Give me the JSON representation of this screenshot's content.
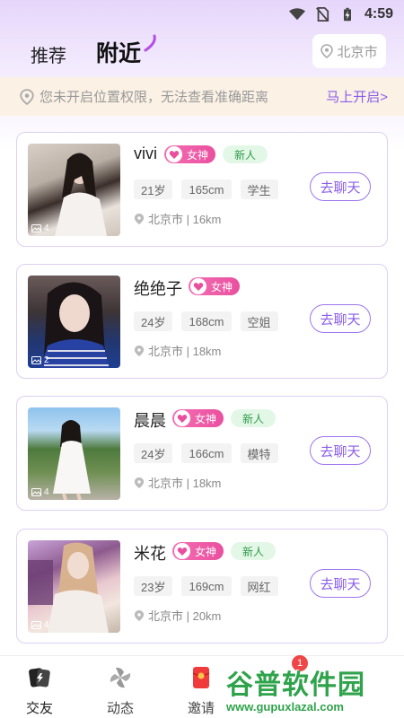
{
  "status_bar": {
    "time": "4:59"
  },
  "header": {
    "tabs": [
      {
        "label": "推荐",
        "active": false
      },
      {
        "label": "附近",
        "active": true
      }
    ],
    "city": "北京市"
  },
  "location_banner": {
    "message": "您未开启位置权限，无法查看准确距离",
    "action": "马上开启>"
  },
  "users": [
    {
      "name": "vivi",
      "badges": [
        "女神",
        "新人"
      ],
      "tags": [
        "21岁",
        "165cm",
        "学生"
      ],
      "location": "北京市 | 16km",
      "photo_count": "4",
      "chat_label": "去聊天"
    },
    {
      "name": "绝绝子",
      "badges": [
        "女神"
      ],
      "tags": [
        "24岁",
        "168cm",
        "空姐"
      ],
      "location": "北京市 | 18km",
      "photo_count": "2",
      "chat_label": "去聊天"
    },
    {
      "name": "晨晨",
      "badges": [
        "女神",
        "新人"
      ],
      "tags": [
        "24岁",
        "166cm",
        "模特"
      ],
      "location": "北京市 | 18km",
      "photo_count": "4",
      "chat_label": "去聊天"
    },
    {
      "name": "米花",
      "badges": [
        "女神",
        "新人"
      ],
      "tags": [
        "23岁",
        "169cm",
        "网红"
      ],
      "location": "北京市 | 20km",
      "photo_count": "4",
      "chat_label": "去聊天"
    }
  ],
  "bottom_nav": {
    "items": [
      {
        "label": "交友",
        "icon": "friends-icon",
        "active": true
      },
      {
        "label": "动态",
        "icon": "moments-icon",
        "active": false
      },
      {
        "label": "邀请",
        "icon": "invite-icon",
        "active": false
      }
    ],
    "notification_count": "1"
  },
  "watermark": {
    "main": "谷普软件园",
    "sub": "www.gupuxlazal.com"
  },
  "colors": {
    "accent": "#8a5ee8",
    "goddess_badge": "#ea4f9f",
    "newbie_badge_bg": "#e3f7e7",
    "newbie_badge_text": "#2e9b49",
    "banner_bg": "#fbf1e5"
  }
}
